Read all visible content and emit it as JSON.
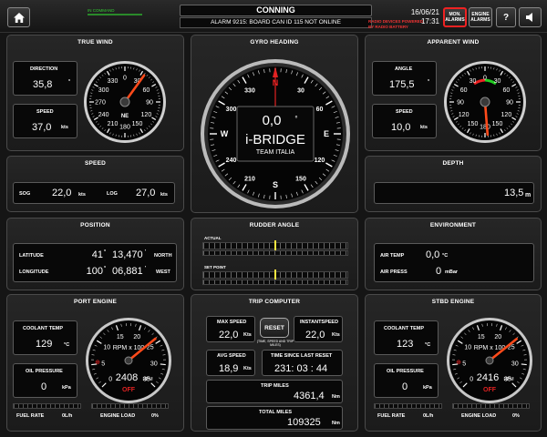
{
  "header": {
    "title": "CONNING",
    "alarm": "ALARM 9215: BOARD CAN ID 115 NOT ONLINE",
    "in_command": "IN COMMAND",
    "date": "16/06/21",
    "time": "17:31",
    "radio_power": "RADIO DEVICES POWERED",
    "radio_power2": "BY RADIO BATTERY",
    "mon_alarms": "MON. ALARMS",
    "mon_alarms_l1": "MON.",
    "mon_alarms_l2": "ALARMS",
    "engine_alarms_l1": "ENGINE",
    "engine_alarms_l2": "ALARMS",
    "help": "?"
  },
  "true_wind": {
    "title": "TRUE WIND",
    "direction_label": "DIRECTION",
    "direction": "35,8",
    "direction_unit": "°",
    "speed_label": "SPEED",
    "speed": "37,0",
    "speed_unit": "kts",
    "dial_ticks": [
      "0",
      "30",
      "60",
      "90",
      "120",
      "150",
      "180",
      "210",
      "240",
      "270",
      "300",
      "330"
    ],
    "dial_text": "NE",
    "needle_deg": 35.8
  },
  "gyro": {
    "title": "GYRO HEADING",
    "value": "0,0",
    "unit": "°",
    "logo": "i-BRIDGE",
    "logo_sub": "TEAM ITALIA",
    "ticks": [
      "N",
      "30",
      "60",
      "E",
      "120",
      "150",
      "S",
      "210",
      "240",
      "W",
      "300",
      "330"
    ]
  },
  "apparent_wind": {
    "title": "APPARENT WIND",
    "angle_label": "ANGLE",
    "angle": "175,5",
    "angle_unit": "°",
    "speed_label": "SPEED",
    "speed": "10,0",
    "speed_unit": "kts",
    "dial_ticks": [
      "0",
      "30",
      "60",
      "90",
      "120",
      "150",
      "180",
      "150",
      "120",
      "90",
      "60",
      "30"
    ],
    "needle_deg": 175.5
  },
  "speed": {
    "title": "SPEED",
    "sog_label": "SOG",
    "sog": "22,0",
    "sog_unit": "kts",
    "log_label": "LOG",
    "log": "27,0",
    "log_unit": "kts"
  },
  "depth": {
    "title": "DEPTH",
    "value": "13,5",
    "unit": "m"
  },
  "position": {
    "title": "POSITION",
    "lat_label": "LATITUDE",
    "lat_deg": "41",
    "lat_deg_unit": "°",
    "lat_min": "13,470",
    "lat_min_unit": "'",
    "lat_dir": "NORTH",
    "lon_label": "LONGITUDE",
    "lon_deg": "100",
    "lon_deg_unit": "°",
    "lon_min": "06,881",
    "lon_min_unit": "'",
    "lon_dir": "WEST"
  },
  "rudder": {
    "title": "RUDDER ANGLE",
    "actual_label": "ACTUAL",
    "set_label": "SET POINT"
  },
  "environment": {
    "title": "ENVIRONMENT",
    "air_temp_label": "AIR TEMP",
    "air_temp": "0,0",
    "air_temp_unit": "°C",
    "air_press_label": "AIR PRESS",
    "air_press": "0",
    "air_press_unit": "mBar"
  },
  "port_engine": {
    "title": "PORT ENGINE",
    "coolant_label": "COOLANT TEMP",
    "coolant": "129",
    "coolant_unit": "°C",
    "oil_label": "OIL PRESSURE",
    "oil": "0",
    "oil_unit": "kPa",
    "dial_label": "RPM x 100",
    "dial_ticks": [
      "0",
      "5",
      "10",
      "15",
      "20",
      "25",
      "30",
      "35"
    ],
    "rpm": "2408",
    "rpm_unit": "RPM",
    "rpm_value": 2408,
    "status": "OFF",
    "fuel_label": "FUEL RATE",
    "fuel": "0L/h",
    "load_label": "ENGINE LOAD",
    "load": "0%"
  },
  "trip": {
    "title": "TRIP COMPUTER",
    "max_label": "MAX SPEED",
    "max": "22,0",
    "max_unit": "Kts",
    "reset": "RESET",
    "reset_note": "(TIME, SPEED AND TRIP MILES)",
    "inst_label": "INSTANTSPEED",
    "inst": "22,0",
    "inst_unit": "Kts",
    "avg_label": "AVG SPEED",
    "avg": "18,9",
    "avg_unit": "Kts",
    "time_label": "TIME SINCE LAST RESET",
    "time": "231: 03 : 44",
    "trip_label": "TRIP MILES",
    "trip": "4361,4",
    "trip_unit": "Nm",
    "total_label": "TOTAL MILES",
    "total": "109325",
    "total_unit": "Nm"
  },
  "stbd_engine": {
    "title": "STBD ENGINE",
    "coolant_label": "COOLANT TEMP",
    "coolant": "123",
    "coolant_unit": "°C",
    "oil_label": "OIL PRESSURE",
    "oil": "0",
    "oil_unit": "kPa",
    "dial_label": "RPM x 100",
    "dial_ticks": [
      "0",
      "5",
      "10",
      "15",
      "20",
      "25",
      "30",
      "35"
    ],
    "rpm": "2416",
    "rpm_unit": "RPM",
    "rpm_value": 2416,
    "status": "OFF",
    "fuel_label": "FUEL RATE",
    "fuel": "0L/h",
    "load_label": "ENGINE LOAD",
    "load": "0%"
  },
  "colors": {
    "background": "#151515",
    "needle": "#ff4a1a",
    "accent_red": "#e22222",
    "in_command": "#33cc33"
  },
  "icons": {
    "home": "home-icon",
    "speaker": "speaker-icon"
  }
}
